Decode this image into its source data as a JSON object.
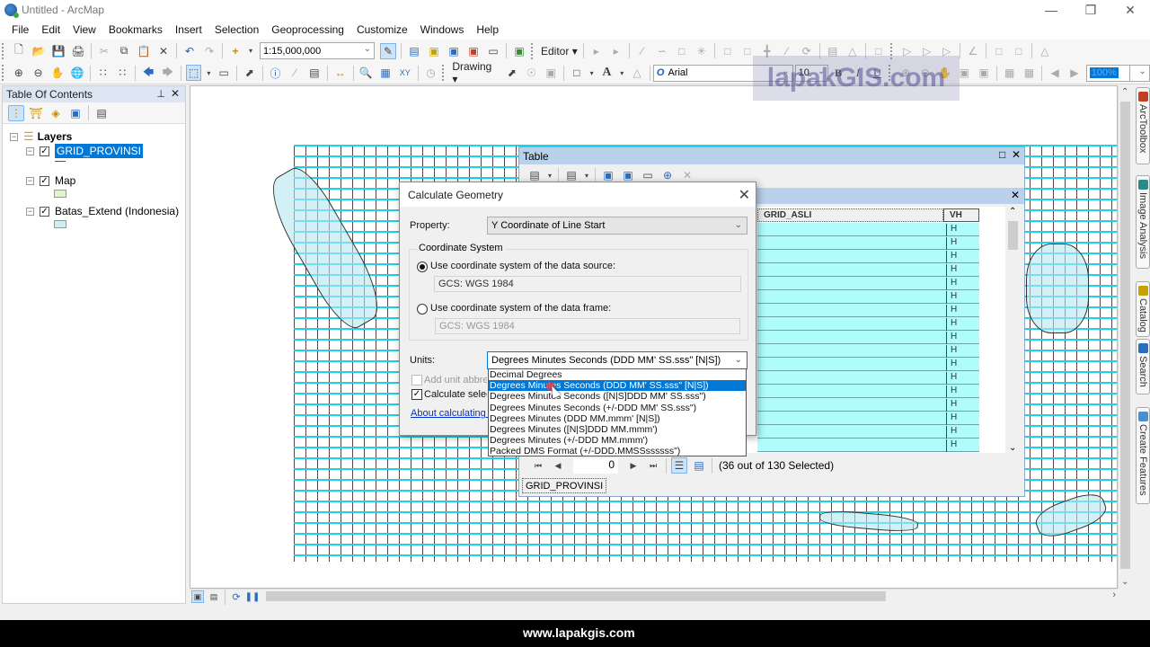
{
  "window": {
    "title": "Untitled - ArcMap",
    "controls": [
      "minimize",
      "restore",
      "close"
    ]
  },
  "menu": [
    "File",
    "Edit",
    "View",
    "Bookmarks",
    "Insert",
    "Selection",
    "Geoprocessing",
    "Customize",
    "Windows",
    "Help"
  ],
  "toolbar": {
    "scale": "1:15,000,000",
    "editor_label": "Editor",
    "drawing_label": "Drawing",
    "font_name": "Arial",
    "font_size": "10",
    "bold": "B",
    "italic": "I",
    "underline": "U",
    "zoom_percent": "100%"
  },
  "toc": {
    "title": "Table Of Contents",
    "root": "Layers",
    "layers": [
      {
        "name": "GRID_PROVINSI",
        "checked": true,
        "selected": true,
        "swatch_color": "#8b3a3a"
      },
      {
        "name": "Map",
        "checked": true,
        "selected": false,
        "swatch_color": "#e2f3d0"
      },
      {
        "name": "Batas_Extend (Indonesia)",
        "checked": true,
        "selected": false,
        "swatch_color": "#cfeef2"
      }
    ]
  },
  "table_window": {
    "title": "Table",
    "columns": [
      "GRID_ASLI",
      "VH"
    ],
    "vh_values": [
      "H",
      "H",
      "H",
      "H",
      "H",
      "H",
      "H",
      "H",
      "H",
      "H",
      "H",
      "H",
      "H",
      "H",
      "H",
      "H",
      "H"
    ],
    "record_index": "0",
    "selection_status": "(36 out of 130 Selected)",
    "tab_label": "GRID_PROVINSI"
  },
  "dialog": {
    "title": "Calculate Geometry",
    "property_label": "Property:",
    "property_value": "Y Coordinate of Line Start",
    "coord_group_label": "Coordinate System",
    "option_source_label": "Use coordinate system of the data source:",
    "option_source_value": "GCS: WGS 1984",
    "option_source_selected": true,
    "option_frame_label": "Use coordinate system of the data frame:",
    "option_frame_value": "GCS: WGS 1984",
    "option_frame_selected": false,
    "units_label": "Units:",
    "units_value": "Degrees Minutes Seconds (DDD MM' SS.sss\" [N|S])",
    "add_unit_label": "Add unit abbreviation",
    "add_unit_checked": false,
    "calc_selected_label": "Calculate selected records only",
    "calc_selected_checked": true,
    "help_link": "About calculating geometry",
    "units_options": [
      "Decimal Degrees",
      "Degrees Minutes Seconds (DDD MM' SS.sss\" [N|S])",
      "Degrees Minutes Seconds ([N|S]DDD MM' SS.sss\")",
      "Degrees Minutes Seconds (+/-DDD MM' SS.sss\")",
      "Degrees Minutes (DDD MM.mmm' [N|S])",
      "Degrees Minutes ([N|S]DDD MM.mmm')",
      "Degrees Minutes (+/-DDD MM.mmm')",
      "Packed DMS Format (+/-DDD.MMSSssssss\")"
    ],
    "units_highlighted_index": 1
  },
  "right_dock": [
    "ArcToolbox",
    "Image Analysis",
    "Catalog",
    "Search",
    "Create Features"
  ],
  "watermark": "lapakGIS.com",
  "footer_url": "www.lapakgis.com"
}
